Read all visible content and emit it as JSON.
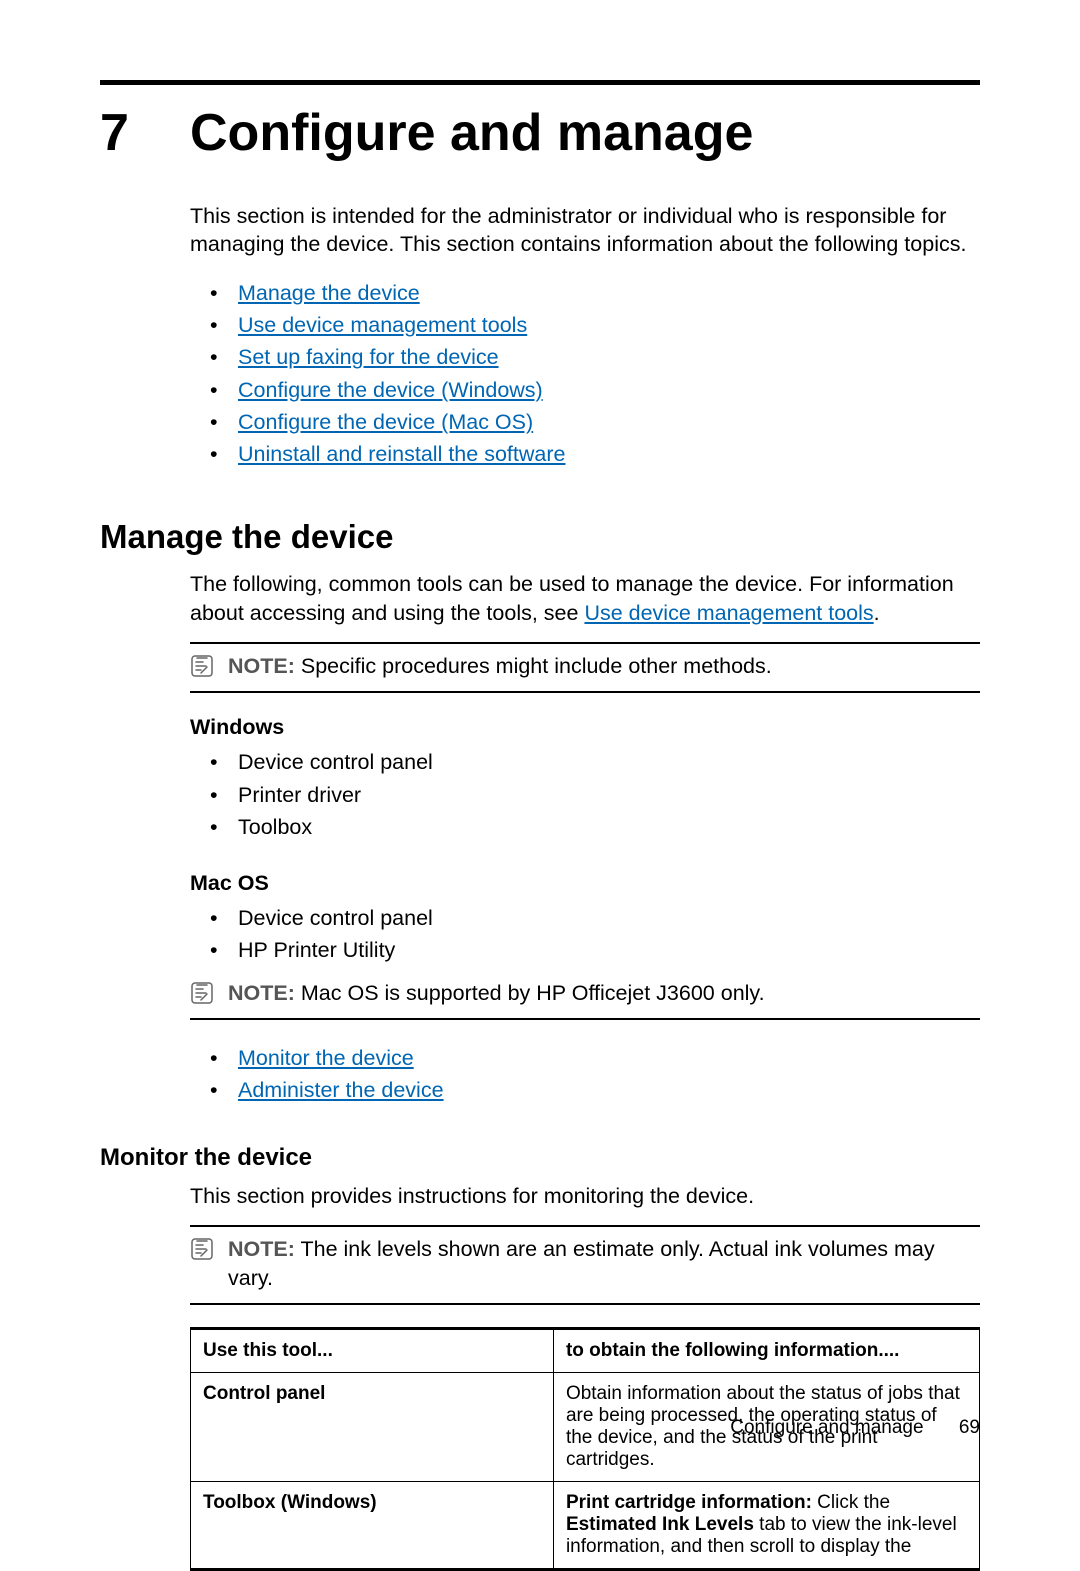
{
  "chapter": {
    "number": "7",
    "title": "Configure and manage"
  },
  "intro": "This section is intended for the administrator or individual who is responsible for managing the device. This section contains information about the following topics.",
  "toc": [
    "Manage the device",
    "Use device management tools",
    "Set up faxing for the device",
    "Configure the device (Windows)",
    "Configure the device (Mac OS)",
    "Uninstall and reinstall the software"
  ],
  "section_manage": {
    "heading": "Manage the device",
    "para_prefix": "The following, common tools can be used to manage the device. For information about accessing and using the tools, see ",
    "para_link": "Use device management tools",
    "para_suffix": ".",
    "note1_label": "NOTE:",
    "note1_body": "Specific procedures might include other methods.",
    "windows_heading": "Windows",
    "windows_items": [
      "Device control panel",
      "Printer driver",
      "Toolbox"
    ],
    "macos_heading": "Mac OS",
    "macos_items": [
      "Device control panel",
      "HP Printer Utility"
    ],
    "note2_label": "NOTE:",
    "note2_body": "Mac OS is supported by HP Officejet J3600 only.",
    "sublinks": [
      "Monitor the device",
      "Administer the device"
    ]
  },
  "section_monitor": {
    "heading": "Monitor the device",
    "para": "This section provides instructions for monitoring the device.",
    "note_label": "NOTE:",
    "note_body": "The ink levels shown are an estimate only. Actual ink volumes may vary.",
    "table": {
      "header": [
        "Use this tool...",
        "to obtain the following information...."
      ],
      "rows": [
        {
          "tool": "Control panel",
          "info": "Obtain information about the status of jobs that are being processed, the operating status of the device, and the status of the print cartridges."
        },
        {
          "tool": "Toolbox (Windows)",
          "info_b1": "Print cartridge information:",
          "info_t1": " Click the ",
          "info_b2": "Estimated Ink Levels",
          "info_t2": " tab to view the ink-level information, and then scroll to display the"
        }
      ]
    }
  },
  "footer": {
    "label": "Configure and manage",
    "page": "69"
  }
}
